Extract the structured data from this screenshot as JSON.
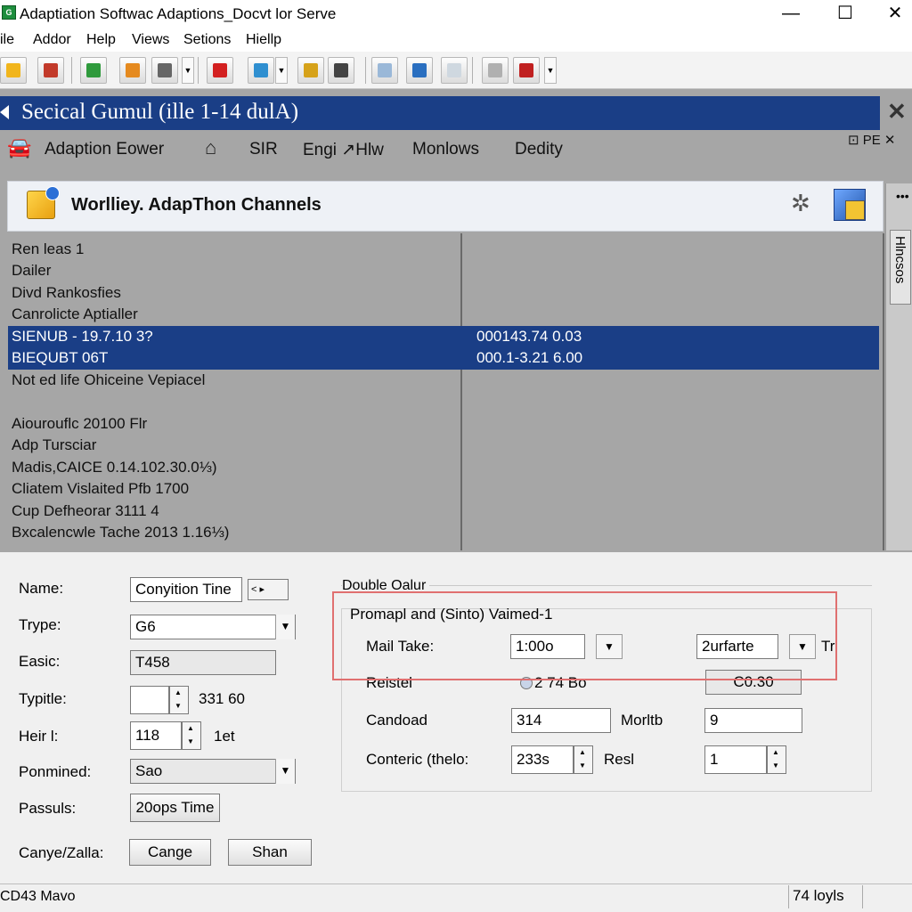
{
  "window": {
    "title": "Adaptiation Softwac Adaptions_Docvt lor Serve",
    "icon_text": "G",
    "minimize": "—",
    "maximize": "☐",
    "close": "✕"
  },
  "menu": [
    "ile",
    "Addor",
    "Help",
    "Views",
    "Setions",
    "Hiellp"
  ],
  "toolbar": {
    "buttons": [
      {
        "icon": "folder-icon",
        "color": "#f1b51c"
      },
      {
        "icon": "tool-icon",
        "color": "#c23a2a"
      },
      {
        "icon": "monitor-icon",
        "color": "#2f9a3c"
      },
      {
        "icon": "edit-icon",
        "color": "#e58a1f"
      },
      {
        "icon": "globe-icon",
        "color": "#666666"
      },
      {
        "icon": "delete-icon",
        "color": "#d32020"
      },
      {
        "icon": "connect-icon",
        "color": "#2f8fd0"
      },
      {
        "icon": "settings-icon",
        "color": "#d6a21a"
      },
      {
        "icon": "report-icon",
        "color": "#444444"
      },
      {
        "icon": "document-icon",
        "color": "#9ab8d8"
      },
      {
        "icon": "keypad-icon",
        "color": "#2a6fc0"
      },
      {
        "icon": "new-icon",
        "color": "#cfd8e0"
      },
      {
        "icon": "copy-icon",
        "color": "#b0b0b0"
      },
      {
        "icon": "chart-icon",
        "color": "#c02020"
      }
    ]
  },
  "panel": {
    "header": "Secical Gumul (ille 1-14 dulA)",
    "close": "✕",
    "subtabs": [
      {
        "label": "Adaption Eower",
        "icon": "car-icon"
      },
      {
        "label": "SIR",
        "icon": "home-icon"
      },
      {
        "label": "Engi ↗Hlw",
        "icon": ""
      },
      {
        "label": "Monlows",
        "icon": ""
      },
      {
        "label": "Dedity",
        "icon": ""
      }
    ],
    "subtab_right": "⊡ PE ✕",
    "content_title": "Worlliey. AdapThon Channels",
    "side_tab_label": "Hlncsos",
    "side_dots": "•••",
    "list": [
      "Ren leas 1",
      "Dailer",
      "Divd Rankosfies",
      "Canrolicte Aptialler",
      "SIENUB - 19.7.10 3?",
      "BIEQUBT 06T",
      "Not ed life Ohiceine Vepiacel",
      "",
      "Aiourouflc 20100 Flr",
      "Adp Tursciar",
      "Madis,CAICE 0.14.102.30.0⅓)",
      "Cliatem Vislaited Pfb 1700",
      "Cup Defheorar 3111 4",
      "Bxcalencwle Tache 2013 1.16⅓)"
    ],
    "selected_values": [
      "000143.74 0.03",
      "000.1-3.21 6.00"
    ]
  },
  "form": {
    "name": {
      "label": "Name:",
      "value": "Conyition Tine",
      "stepper": "<  ▸"
    },
    "type": {
      "label": "Trype:",
      "value": "G6"
    },
    "basic": {
      "label": "Easic:",
      "value": "T458"
    },
    "typitle": {
      "label": "Typitle:",
      "value": "",
      "unit": "331 60"
    },
    "heir": {
      "label": "Heir l:",
      "value": "118",
      "unit": "1et"
    },
    "ponmined": {
      "label": "Ponmined:",
      "value": "Sao"
    },
    "passuls": {
      "label": "Passuls:",
      "value": "20ops Time"
    },
    "canye": {
      "label": "Canye/Zalla:",
      "button1": "Cange",
      "button2": "Shan"
    }
  },
  "group": {
    "title": "Double Oalur",
    "subtitle": "Promapl and (Sinto) Vaimed-1",
    "mail_take": {
      "label": "Mail Take:",
      "value": "1:00o",
      "second": "2urfarte",
      "suffix": "Tr"
    },
    "reistel": {
      "label": "Reistel",
      "radio_text": "2 74 Bo",
      "value": "C0.30"
    },
    "candoad": {
      "label": "Candoad",
      "value": "314",
      "second_label": "Morltb",
      "second_value": "9"
    },
    "conteric": {
      "label": "Conteric (thelo:",
      "value": "233s",
      "second_label": "Resl",
      "second_value": "1"
    }
  },
  "status": {
    "left": "CD43 Mavo",
    "right": "74 loyls"
  }
}
